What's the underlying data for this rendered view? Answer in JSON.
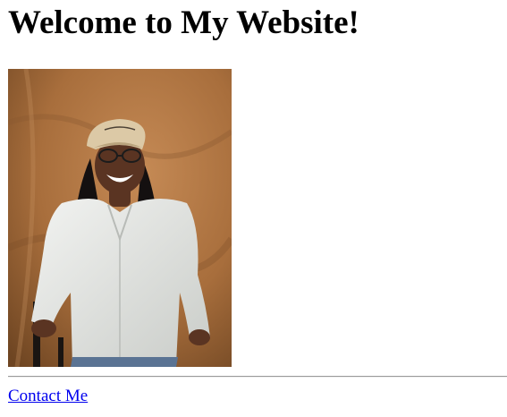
{
  "page": {
    "heading": "Welcome to My Website!",
    "contact_link_text": "Contact Me"
  },
  "photo": {
    "subject": "smiling person in cap, glasses and white shirt",
    "colors": {
      "backdrop": "#a86e3c",
      "shirt": "#e4e6e2",
      "cap": "#dcc9a6",
      "hair": "#141010",
      "skin": "#5a3422",
      "jeans": "#5a7393"
    }
  },
  "colors": {
    "link": "#0000ee",
    "divider": "#9a9a9a",
    "text": "#000000"
  }
}
